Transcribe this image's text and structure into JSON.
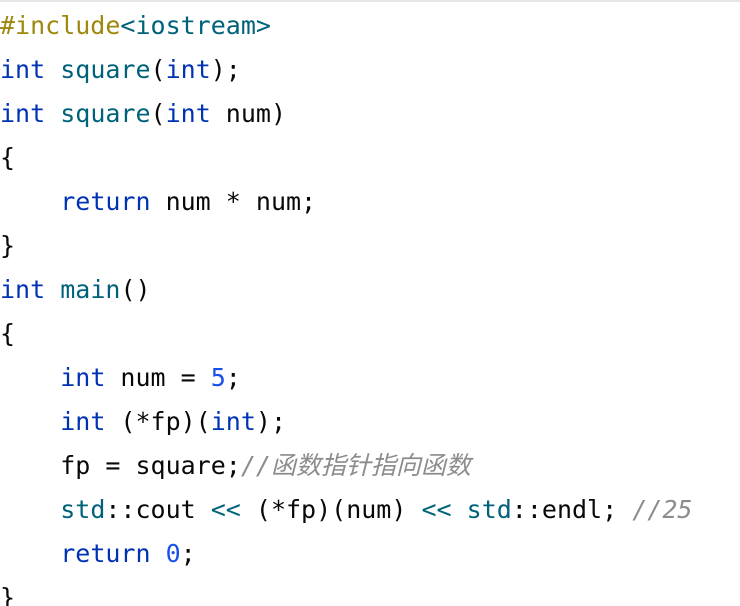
{
  "editor": {
    "colors": {
      "text": "#080808",
      "keyword": "#0033b3",
      "function": "#00627a",
      "preprocessor": "#9e880d",
      "number": "#1750eb",
      "comment": "#8c8c8c",
      "operator_ns": "#00627a"
    },
    "lines": [
      {
        "tokens": [
          {
            "t": "#include",
            "k": "preprocessor"
          },
          {
            "t": "<iostream>",
            "k": "function"
          }
        ]
      },
      {
        "tokens": [
          {
            "t": "int",
            "k": "keyword"
          },
          {
            "t": " ",
            "k": "text"
          },
          {
            "t": "square",
            "k": "function"
          },
          {
            "t": "(",
            "k": "text"
          },
          {
            "t": "int",
            "k": "keyword"
          },
          {
            "t": ");",
            "k": "text"
          }
        ]
      },
      {
        "tokens": [
          {
            "t": "int",
            "k": "keyword"
          },
          {
            "t": " ",
            "k": "text"
          },
          {
            "t": "square",
            "k": "function"
          },
          {
            "t": "(",
            "k": "text"
          },
          {
            "t": "int",
            "k": "keyword"
          },
          {
            "t": " num)",
            "k": "text"
          }
        ]
      },
      {
        "tokens": [
          {
            "t": "{",
            "k": "text"
          }
        ]
      },
      {
        "tokens": [
          {
            "t": "    ",
            "k": "text"
          },
          {
            "t": "return",
            "k": "keyword"
          },
          {
            "t": " num * num;",
            "k": "text"
          }
        ]
      },
      {
        "tokens": [
          {
            "t": "}",
            "k": "text"
          }
        ]
      },
      {
        "tokens": [
          {
            "t": "int",
            "k": "keyword"
          },
          {
            "t": " ",
            "k": "text"
          },
          {
            "t": "main",
            "k": "function"
          },
          {
            "t": "()",
            "k": "text"
          }
        ]
      },
      {
        "tokens": [
          {
            "t": "{",
            "k": "text"
          }
        ]
      },
      {
        "tokens": [
          {
            "t": "    ",
            "k": "text"
          },
          {
            "t": "int",
            "k": "keyword"
          },
          {
            "t": " num = ",
            "k": "text"
          },
          {
            "t": "5",
            "k": "number"
          },
          {
            "t": ";",
            "k": "text"
          }
        ]
      },
      {
        "tokens": [
          {
            "t": "    ",
            "k": "text"
          },
          {
            "t": "int",
            "k": "keyword"
          },
          {
            "t": " (*fp)(",
            "k": "text"
          },
          {
            "t": "int",
            "k": "keyword"
          },
          {
            "t": ");",
            "k": "text"
          }
        ]
      },
      {
        "tokens": [
          {
            "t": "    fp = square;",
            "k": "text"
          },
          {
            "t": "//函数指针指向函数",
            "k": "comment"
          }
        ]
      },
      {
        "tokens": [
          {
            "t": "    ",
            "k": "text"
          },
          {
            "t": "std",
            "k": "operator_ns"
          },
          {
            "t": "::cout ",
            "k": "text"
          },
          {
            "t": "<<",
            "k": "operator_ns"
          },
          {
            "t": " (*fp)(num) ",
            "k": "text"
          },
          {
            "t": "<<",
            "k": "operator_ns"
          },
          {
            "t": " ",
            "k": "text"
          },
          {
            "t": "std",
            "k": "operator_ns"
          },
          {
            "t": "::endl; ",
            "k": "text"
          },
          {
            "t": "//25",
            "k": "comment"
          }
        ]
      },
      {
        "tokens": [
          {
            "t": "    ",
            "k": "text"
          },
          {
            "t": "return",
            "k": "keyword"
          },
          {
            "t": " ",
            "k": "text"
          },
          {
            "t": "0",
            "k": "number"
          },
          {
            "t": ";",
            "k": "text"
          }
        ]
      },
      {
        "tokens": [
          {
            "t": "}",
            "k": "text"
          }
        ]
      }
    ]
  }
}
